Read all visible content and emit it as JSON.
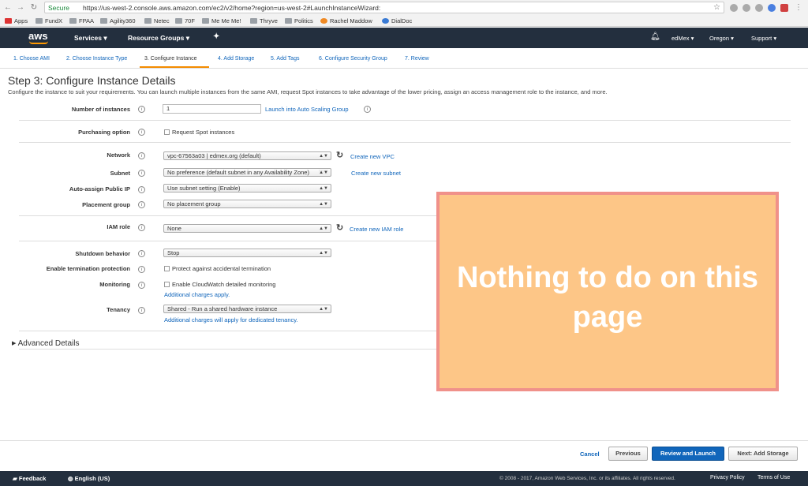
{
  "browser": {
    "secure_label": "Secure",
    "url": "https://us-west-2.console.aws.amazon.com/ec2/v2/home?region=us-west-2#LaunchInstanceWizard:",
    "bookmarks": [
      "Apps",
      "FundX",
      "FPAA",
      "Agility360",
      "Netec",
      "70F",
      "Me Me Me!",
      "Thryve",
      "Politics",
      "Rachel Maddow",
      "DialDoc"
    ]
  },
  "nav": {
    "logo": "aws",
    "services": "Services",
    "resource_groups": "Resource Groups",
    "user": "edMex",
    "region": "Oregon",
    "support": "Support"
  },
  "steps": [
    "1. Choose AMI",
    "2. Choose Instance Type",
    "3. Configure Instance",
    "4. Add Storage",
    "5. Add Tags",
    "6. Configure Security Group",
    "7. Review"
  ],
  "page": {
    "title": "Step 3: Configure Instance Details",
    "subtitle": "Configure the instance to suit your requirements. You can launch multiple instances from the same AMI, request Spot instances to take advantage of the lower pricing, assign an access management role to the instance, and more."
  },
  "form": {
    "num_instances_label": "Number of instances",
    "num_instances_value": "1",
    "auto_scaling_link": "Launch into Auto Scaling Group",
    "purchasing_label": "Purchasing option",
    "spot_label": "Request Spot instances",
    "network_label": "Network",
    "network_value": "vpc-67563a03 | edmex.org (default)",
    "create_vpc": "Create new VPC",
    "subnet_label": "Subnet",
    "subnet_value": "No preference (default subnet in any Availability Zone)",
    "create_subnet": "Create new subnet",
    "public_ip_label": "Auto-assign Public IP",
    "public_ip_value": "Use subnet setting (Enable)",
    "placement_label": "Placement group",
    "placement_value": "No placement group",
    "iam_label": "IAM role",
    "iam_value": "None",
    "create_iam": "Create new IAM role",
    "shutdown_label": "Shutdown behavior",
    "shutdown_value": "Stop",
    "termination_label": "Enable termination protection",
    "termination_cb": "Protect against accidental termination",
    "monitoring_label": "Monitoring",
    "monitoring_cb": "Enable CloudWatch detailed monitoring",
    "monitoring_note": "Additional charges apply.",
    "tenancy_label": "Tenancy",
    "tenancy_value": "Shared - Run a shared hardware instance",
    "tenancy_note": "Additional charges will apply for dedicated tenancy.",
    "advanced": "Advanced Details"
  },
  "overlay": {
    "text": "Nothing to do on this page"
  },
  "buttons": {
    "cancel": "Cancel",
    "previous": "Previous",
    "review": "Review and Launch",
    "next": "Next: Add Storage"
  },
  "footer": {
    "feedback": "Feedback",
    "language": "English (US)",
    "copyright": "© 2008 - 2017, Amazon Web Services, Inc. or its affiliates. All rights reserved.",
    "privacy": "Privacy Policy",
    "terms": "Terms of Use"
  }
}
